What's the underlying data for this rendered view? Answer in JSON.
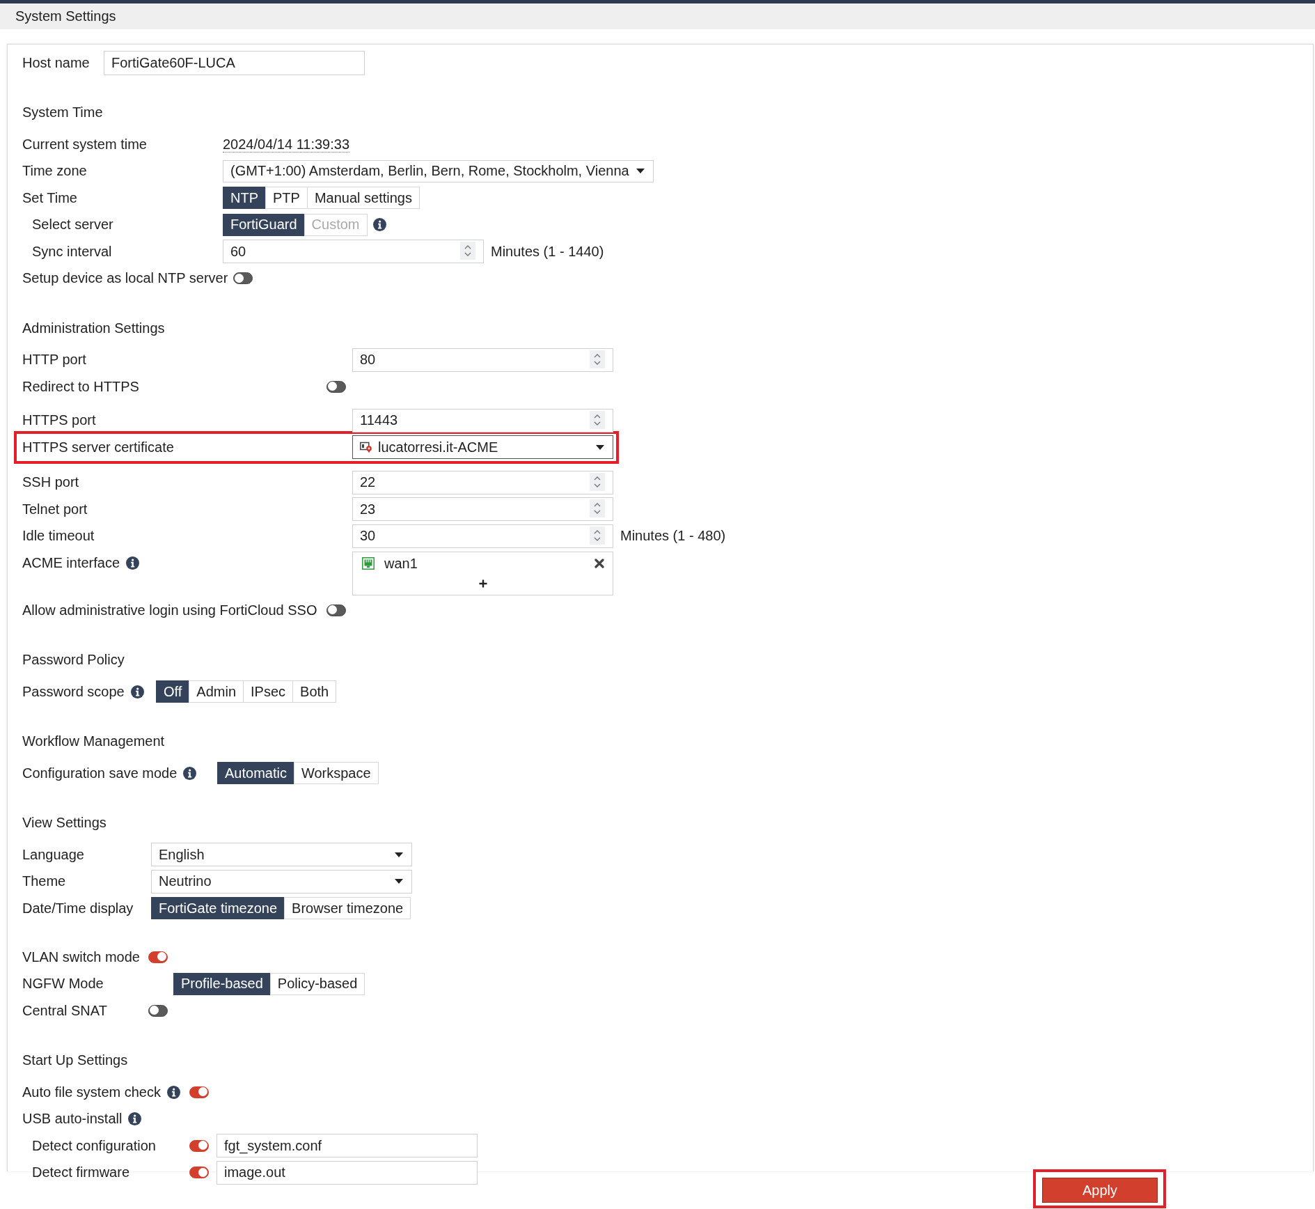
{
  "header": {
    "title": "System Settings"
  },
  "host": {
    "label": "Host name",
    "value": "FortiGate60F-LUCA"
  },
  "sections": [
    {
      "title": "System Time",
      "rows": [
        {
          "kind": "text",
          "label": "Current system time",
          "value": "2024/04/14 11:39:33",
          "highlighted": false
        },
        {
          "kind": "select",
          "label": "Time zone",
          "value": "(GMT+1:00) Amsterdam, Berlin, Bern, Rome, Stockholm, Vienna",
          "highlighted": false
        },
        {
          "kind": "segmented",
          "label": "Set Time",
          "highlighted": false,
          "options": [
            {
              "label": "NTP",
              "selected": true,
              "disabled": false
            },
            {
              "label": "PTP",
              "selected": false,
              "disabled": false
            },
            {
              "label": "Manual settings",
              "selected": false,
              "disabled": false
            }
          ],
          "children": [
            {
              "kind": "segmented",
              "label": "Select server",
              "highlighted": false,
              "info": true,
              "options": [
                {
                  "label": "FortiGuard",
                  "selected": true,
                  "disabled": false
                },
                {
                  "label": "Custom",
                  "selected": false,
                  "disabled": true
                }
              ]
            },
            {
              "kind": "number",
              "label": "Sync interval",
              "value": "60",
              "suffix": "Minutes (1 - 1440)",
              "highlighted": false
            }
          ]
        },
        {
          "kind": "toggle",
          "label": "Setup device as local NTP server",
          "on": false,
          "highlighted": false
        }
      ]
    },
    {
      "title": "Administration Settings",
      "rows": [
        {
          "kind": "number",
          "label": "HTTP port",
          "value": "80",
          "highlighted": false
        },
        {
          "kind": "toggle",
          "label": "Redirect to HTTPS",
          "on": false,
          "highlighted": false
        },
        {
          "kind": "number",
          "label": "HTTPS port",
          "value": "11443",
          "highlighted": false
        },
        {
          "kind": "certificate",
          "label": "HTTPS server certificate",
          "value": "lucatorresi.it-ACME",
          "highlighted": true
        },
        {
          "kind": "number",
          "label": "SSH port",
          "value": "22",
          "highlighted": false
        },
        {
          "kind": "number",
          "label": "Telnet port",
          "value": "23",
          "highlighted": false
        },
        {
          "kind": "number",
          "label": "Idle timeout",
          "value": "30",
          "suffix": "Minutes (1 - 480)",
          "highlighted": false
        },
        {
          "kind": "interfaces",
          "label": "ACME interface",
          "info": true,
          "items": [
            {
              "name": "wan1"
            }
          ],
          "highlighted": false
        },
        {
          "kind": "toggle",
          "label": "Allow administrative login using FortiCloud SSO",
          "on": false,
          "highlighted": false
        }
      ]
    },
    {
      "title": "Password Policy",
      "rows": [
        {
          "kind": "segmented",
          "label": "Password scope",
          "info": true,
          "highlighted": false,
          "options": [
            {
              "label": "Off",
              "selected": true,
              "disabled": false
            },
            {
              "label": "Admin",
              "selected": false,
              "disabled": false
            },
            {
              "label": "IPsec",
              "selected": false,
              "disabled": false
            },
            {
              "label": "Both",
              "selected": false,
              "disabled": false
            }
          ]
        }
      ]
    },
    {
      "title": "Workflow Management",
      "rows": [
        {
          "kind": "segmented",
          "label": "Configuration save mode",
          "info": true,
          "highlighted": false,
          "options": [
            {
              "label": "Automatic",
              "selected": true,
              "disabled": false
            },
            {
              "label": "Workspace",
              "selected": false,
              "disabled": false
            }
          ]
        }
      ]
    },
    {
      "title": "View Settings",
      "rows": [
        {
          "kind": "select",
          "label": "Language",
          "value": "English",
          "highlighted": false
        },
        {
          "kind": "select",
          "label": "Theme",
          "value": "Neutrino",
          "highlighted": false
        },
        {
          "kind": "segmented",
          "label": "Date/Time display",
          "highlighted": false,
          "options": [
            {
              "label": "FortiGate timezone",
              "selected": true,
              "disabled": false
            },
            {
              "label": "Browser timezone",
              "selected": false,
              "disabled": false
            }
          ]
        }
      ]
    },
    {
      "rows": [
        {
          "kind": "toggle",
          "label": "VLAN switch mode",
          "on": true,
          "highlighted": false
        },
        {
          "kind": "segmented",
          "label": "NGFW Mode",
          "highlighted": false,
          "options": [
            {
              "label": "Profile-based",
              "selected": true,
              "disabled": false
            },
            {
              "label": "Policy-based",
              "selected": false,
              "disabled": false
            }
          ]
        },
        {
          "kind": "toggle",
          "label": "Central SNAT",
          "on": false,
          "highlighted": false
        }
      ]
    },
    {
      "title": "Start Up Settings",
      "rows": [
        {
          "kind": "toggle",
          "label": "Auto file system check",
          "info": true,
          "on": true,
          "highlighted": false
        },
        {
          "kind": "label",
          "label": "USB auto-install",
          "info": true,
          "highlighted": false,
          "children": [
            {
              "kind": "toggle_field",
              "label": "Detect configuration",
              "on": true,
              "value": "fgt_system.conf",
              "highlighted": false
            },
            {
              "kind": "toggle_field",
              "label": "Detect firmware",
              "on": true,
              "value": "image.out",
              "highlighted": false
            }
          ]
        }
      ]
    }
  ],
  "apply_button": {
    "label": "Apply",
    "highlighted": true
  }
}
